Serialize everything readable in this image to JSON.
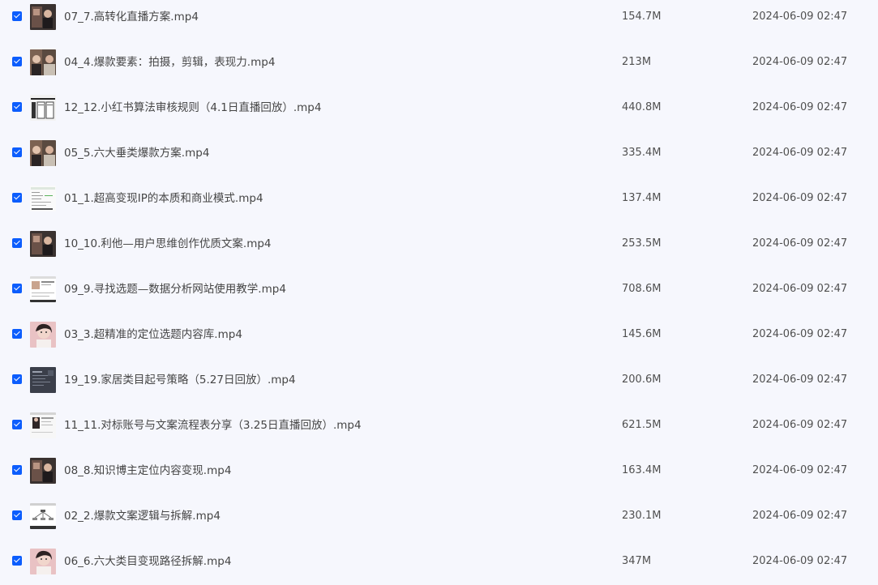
{
  "files": [
    {
      "name": "07_7.高转化直播方案.mp4",
      "size": "154.7M",
      "date": "2024-06-09 02:47",
      "thumb": "dark-portrait-thumbnail",
      "checked": true
    },
    {
      "name": "04_4.爆款要素：拍摄，剪辑，表现力.mp4",
      "size": "213M",
      "date": "2024-06-09 02:47",
      "thumb": "two-portrait-thumbnail",
      "checked": true
    },
    {
      "name": "12_12.小红书算法审核规则（4.1日直播回放）.mp4",
      "size": "440.8M",
      "date": "2024-06-09 02:47",
      "thumb": "document-slides-thumbnail",
      "checked": true
    },
    {
      "name": "05_5.六大垂类爆款方案.mp4",
      "size": "335.4M",
      "date": "2024-06-09 02:47",
      "thumb": "two-portrait-thumbnail",
      "checked": true
    },
    {
      "name": "01_1.超高变现IP的本质和商业模式.mp4",
      "size": "137.4M",
      "date": "2024-06-09 02:47",
      "thumb": "spreadsheet-thumbnail",
      "checked": true
    },
    {
      "name": "10_10.利他—用户思维创作优质文案.mp4",
      "size": "253.5M",
      "date": "2024-06-09 02:47",
      "thumb": "dark-portrait-thumbnail",
      "checked": true
    },
    {
      "name": "09_9.寻找选题—数据分析网站使用教学.mp4",
      "size": "708.6M",
      "date": "2024-06-09 02:47",
      "thumb": "webpage-thumbnail",
      "checked": true
    },
    {
      "name": "03_3.超精准的定位选题内容库.mp4",
      "size": "145.6M",
      "date": "2024-06-09 02:47",
      "thumb": "face-pink-thumbnail",
      "checked": true
    },
    {
      "name": "19_19.家居类目起号策略（5.27日回放）.mp4",
      "size": "200.6M",
      "date": "2024-06-09 02:47",
      "thumb": "dark-slide-thumbnail",
      "checked": true
    },
    {
      "name": "11_11.对标账号与文案流程表分享（3.25日直播回放）.mp4",
      "size": "621.5M",
      "date": "2024-06-09 02:47",
      "thumb": "webpage-person-thumbnail",
      "checked": true
    },
    {
      "name": "08_8.知识博主定位内容变现.mp4",
      "size": "163.4M",
      "date": "2024-06-09 02:47",
      "thumb": "dark-portrait-thumbnail",
      "checked": true
    },
    {
      "name": "02_2.爆款文案逻辑与拆解.mp4",
      "size": "230.1M",
      "date": "2024-06-09 02:47",
      "thumb": "mindmap-thumbnail",
      "checked": true
    },
    {
      "name": "06_6.六大类目变现路径拆解.mp4",
      "size": "347M",
      "date": "2024-06-09 02:47",
      "thumb": "face-pink-thumbnail",
      "checked": true
    }
  ]
}
